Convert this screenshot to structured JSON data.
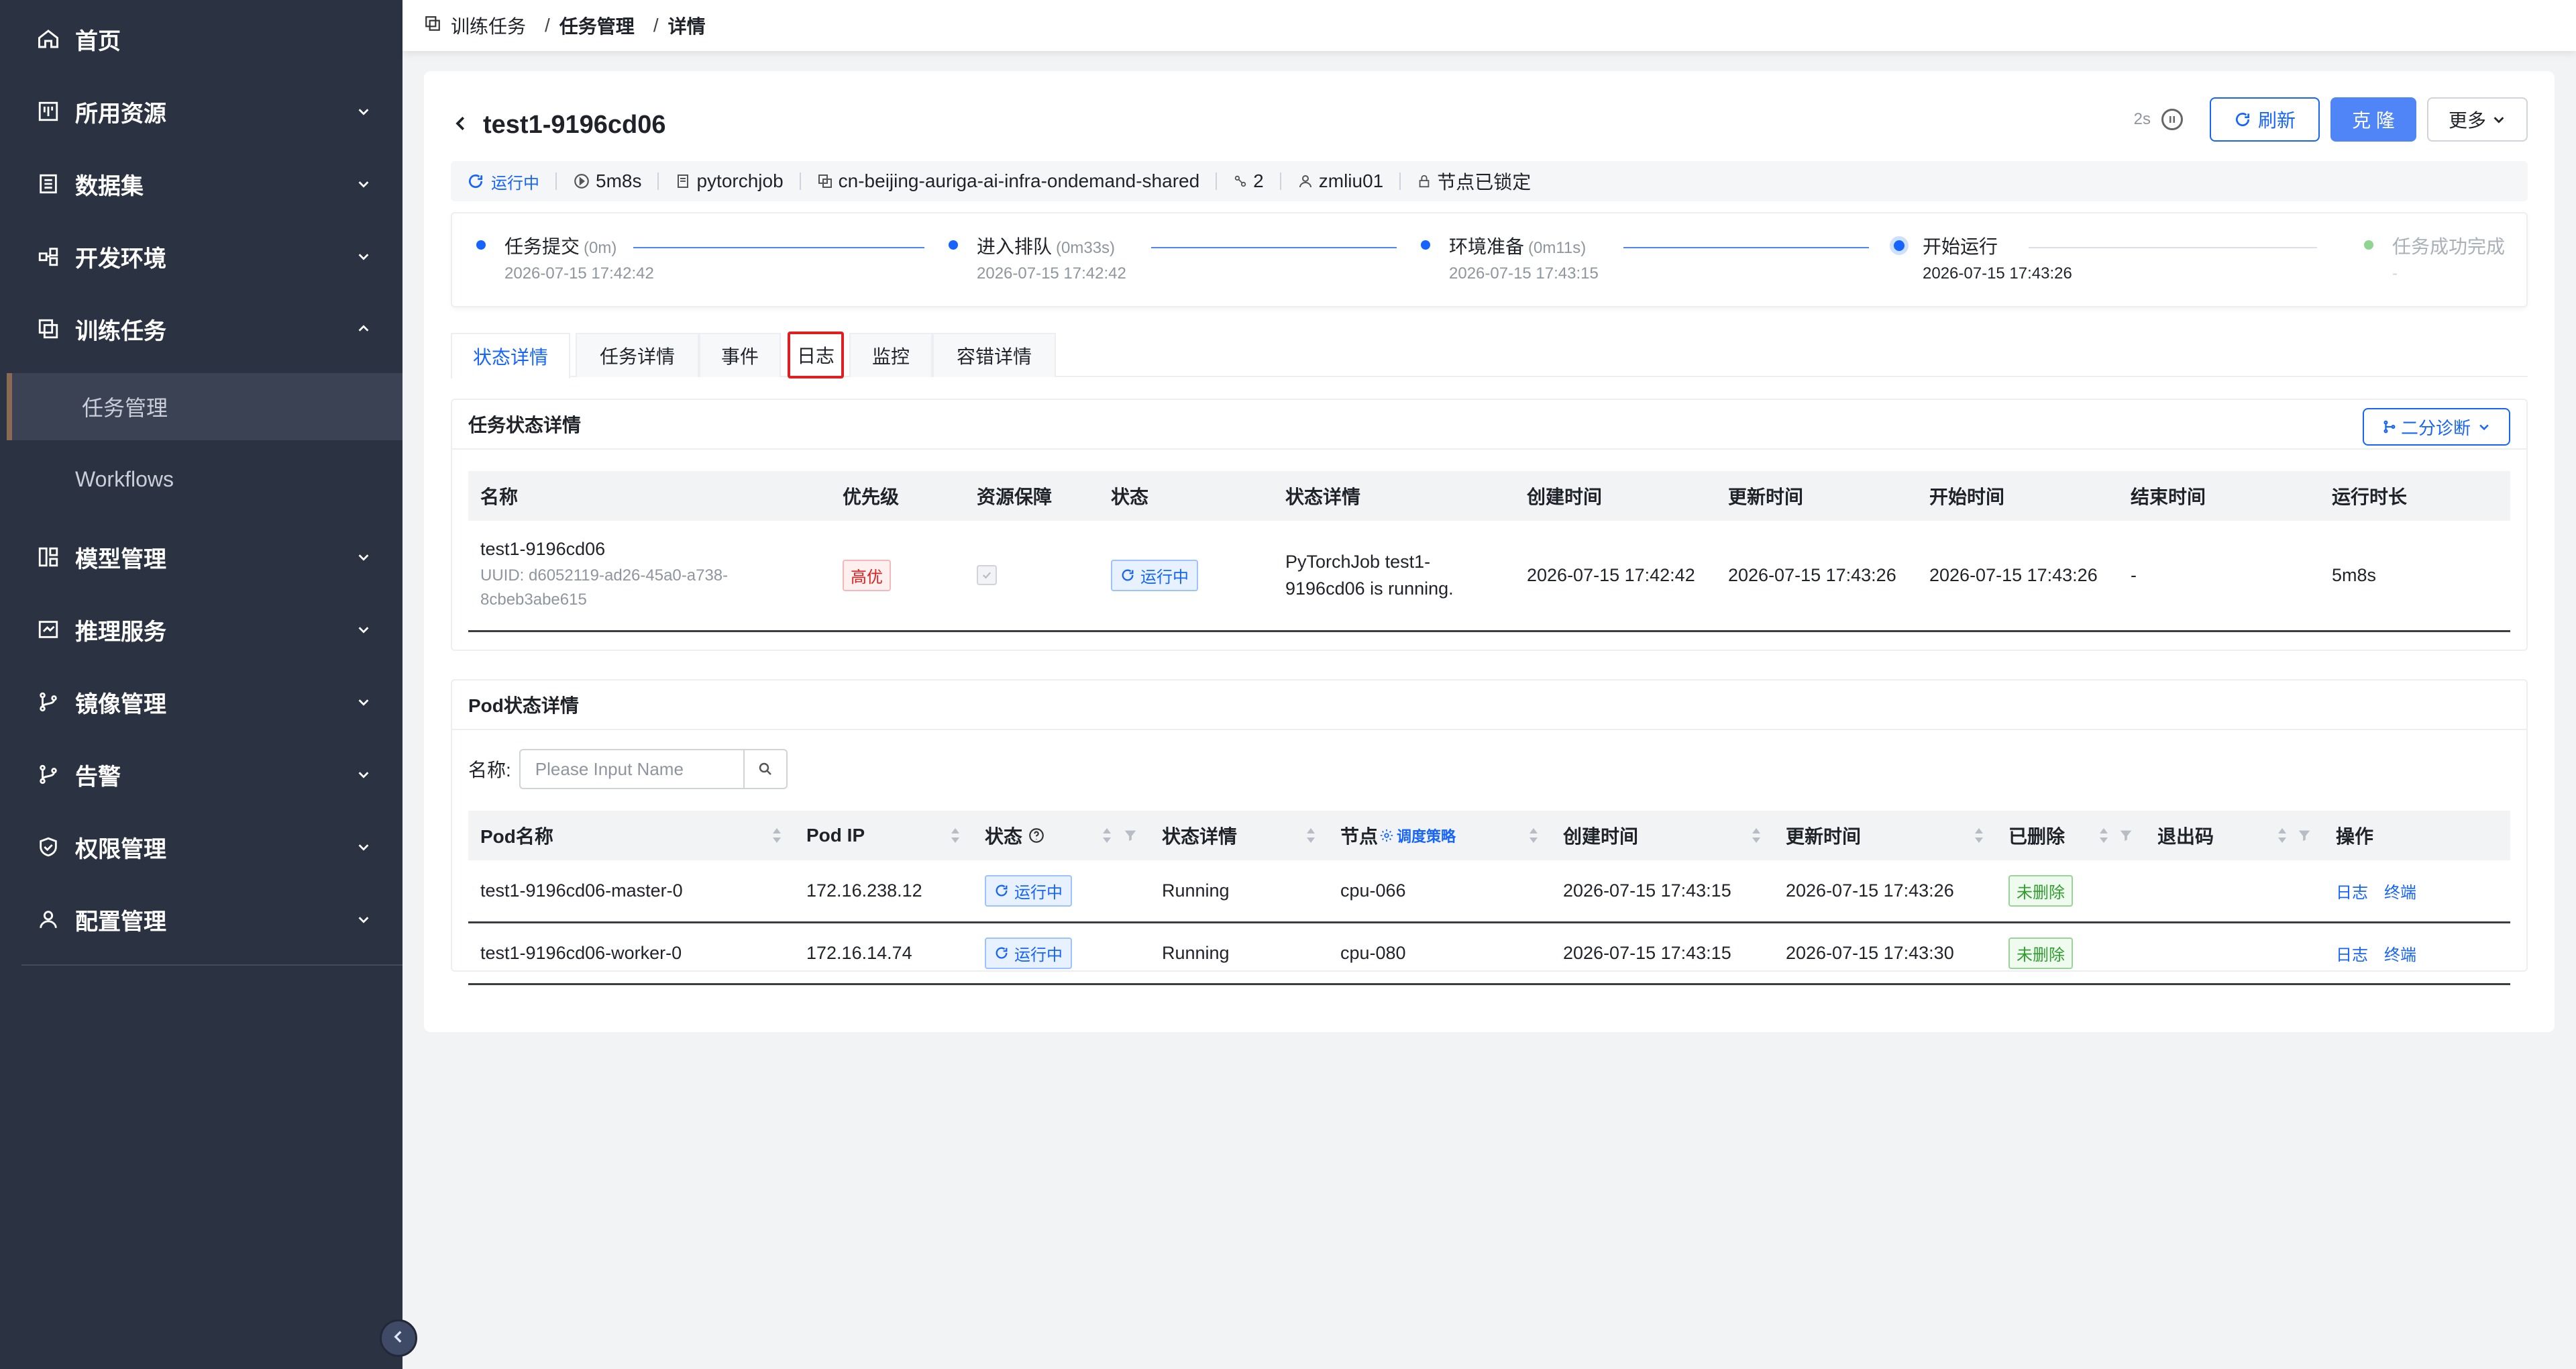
{
  "sidebar": {
    "items": [
      {
        "label": "首页",
        "icon": "home-icon"
      },
      {
        "label": "所用资源",
        "icon": "resource-icon"
      },
      {
        "label": "数据集",
        "icon": "dataset-icon"
      },
      {
        "label": "开发环境",
        "icon": "dev-env-icon"
      },
      {
        "label": "训练任务",
        "icon": "training-icon"
      },
      {
        "label": "任务管理"
      },
      {
        "label": "Workflows"
      },
      {
        "label": "模型管理",
        "icon": "model-icon"
      },
      {
        "label": "推理服务",
        "icon": "inference-icon"
      },
      {
        "label": "镜像管理",
        "icon": "image-icon"
      },
      {
        "label": "告警",
        "icon": "alert-icon"
      },
      {
        "label": "权限管理",
        "icon": "permission-icon"
      },
      {
        "label": "配置管理",
        "icon": "config-icon"
      }
    ]
  },
  "breadcrumb": {
    "root": "训练任务",
    "mid": "任务管理",
    "leaf": "详情",
    "sep": "/"
  },
  "header": {
    "title": "test1-9196cd06",
    "refresh_interval": "2s",
    "refresh_label": "刷新",
    "clone_label": "克 隆",
    "more_label": "更多"
  },
  "meta": {
    "status": "运行中",
    "duration": "5m8s",
    "job_type": "pytorchjob",
    "cluster": "cn-beijing-auriga-ai-infra-ondemand-shared",
    "replicas": "2",
    "user": "zmliu01",
    "lock": "节点已锁定"
  },
  "steps": [
    {
      "title": "任务提交",
      "dur": "(0m)",
      "time": "2026-07-15 17:42:42"
    },
    {
      "title": "进入排队",
      "dur": "(0m33s)",
      "time": "2026-07-15 17:42:42"
    },
    {
      "title": "环境准备",
      "dur": "(0m11s)",
      "time": "2026-07-15 17:43:15"
    },
    {
      "title": "开始运行",
      "dur": "",
      "time": "2026-07-15 17:43:26"
    },
    {
      "title": "任务成功完成",
      "dur": "",
      "time": "-"
    }
  ],
  "tabs": [
    "状态详情",
    "任务详情",
    "事件",
    "日志",
    "监控",
    "容错详情"
  ],
  "task_status": {
    "title": "任务状态详情",
    "diag_label": "二分诊断",
    "columns": [
      "名称",
      "优先级",
      "资源保障",
      "状态",
      "状态详情",
      "创建时间",
      "更新时间",
      "开始时间",
      "结束时间",
      "运行时长"
    ],
    "row": {
      "name": "test1-9196cd06",
      "uuid": "UUID: d6052119-ad26-45a0-a738-8cbeb3abe615",
      "priority": "高优",
      "status": "运行中",
      "detail": "PyTorchJob test1-9196cd06 is running.",
      "created": "2026-07-15 17:42:42",
      "updated": "2026-07-15 17:43:26",
      "started": "2026-07-15 17:43:26",
      "ended": "-",
      "duration": "5m8s"
    }
  },
  "pods": {
    "title": "Pod状态详情",
    "filter_label": "名称:",
    "filter_placeholder": "Please Input Name",
    "columns": [
      "Pod名称",
      "Pod IP",
      "状态",
      "状态详情",
      "节点",
      "创建时间",
      "更新时间",
      "已删除",
      "退出码",
      "操作"
    ],
    "sched_label": "调度策略",
    "rows": [
      {
        "name": "test1-9196cd06-master-0",
        "ip": "172.16.238.12",
        "status": "运行中",
        "detail": "Running",
        "node": "cpu-066",
        "created": "2026-07-15 17:43:15",
        "updated": "2026-07-15 17:43:26",
        "deleted": "未删除",
        "exit_code": "",
        "log": "日志",
        "terminal": "终端"
      },
      {
        "name": "test1-9196cd06-worker-0",
        "ip": "172.16.14.74",
        "status": "运行中",
        "detail": "Running",
        "node": "cpu-080",
        "created": "2026-07-15 17:43:15",
        "updated": "2026-07-15 17:43:30",
        "deleted": "未删除",
        "exit_code": "",
        "log": "日志",
        "terminal": "终端"
      }
    ]
  },
  "colors": {
    "accent": "#1664ff",
    "sidebar_bg": "#2b3242",
    "danger": "#e02020",
    "success": "#2f9e2f"
  }
}
